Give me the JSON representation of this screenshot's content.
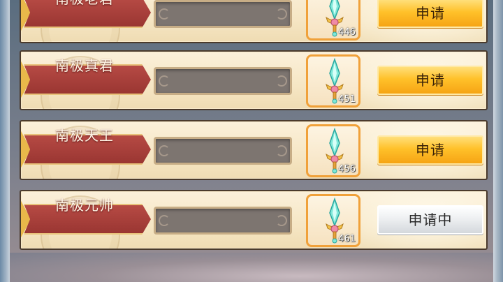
{
  "rows": [
    {
      "name": "南极老君",
      "progress": 0,
      "item_count": "446",
      "action": "申请",
      "state": "available"
    },
    {
      "name": "南极真君",
      "progress": 0,
      "item_count": "451",
      "action": "申请",
      "state": "available"
    },
    {
      "name": "南极天王",
      "progress": 0,
      "item_count": "456",
      "action": "申请",
      "state": "available"
    },
    {
      "name": "南极元帅",
      "progress": 0,
      "item_count": "461",
      "action": "申请中",
      "state": "pending"
    }
  ],
  "colors": {
    "banner_red": "#b64a44",
    "slot_border": "#f0a13a",
    "button_gold": "#ffc12a",
    "button_pending": "#e6e8ea"
  },
  "icons": {
    "item": "crystal-sword-icon"
  }
}
